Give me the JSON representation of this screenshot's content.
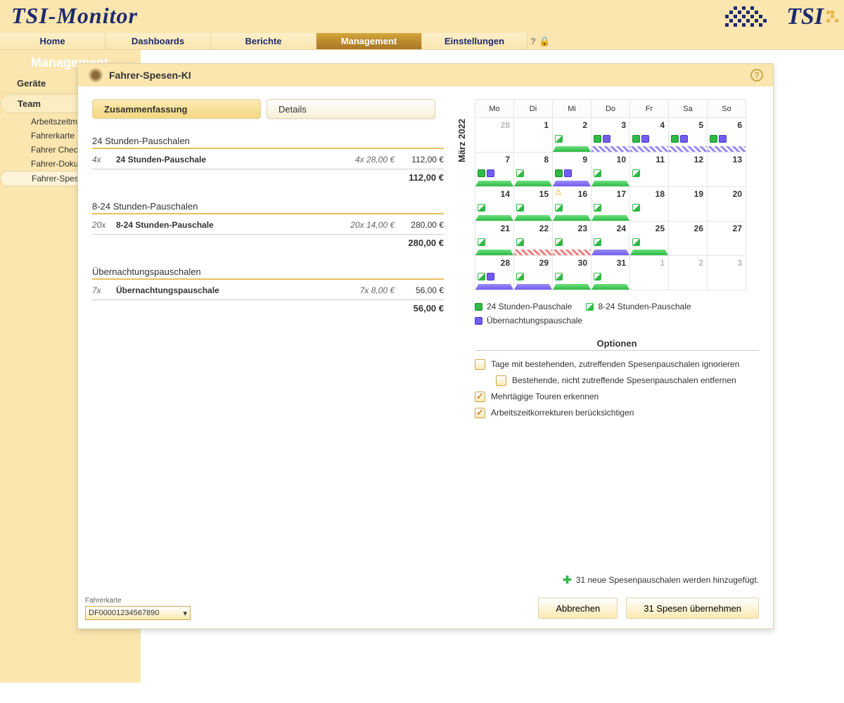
{
  "app_title": "TSI-Monitor",
  "nav": {
    "items": [
      "Home",
      "Dashboards",
      "Berichte",
      "Management",
      "Einstellungen"
    ],
    "active": 3
  },
  "sidebar": {
    "title": "Management",
    "items": [
      "Geräte",
      "Team"
    ],
    "subs": [
      "Arbeitszeitmodell",
      "Fahrerkarte",
      "Fahrer Check",
      "Fahrer-Dokumente",
      "Fahrer-Spesen-KI"
    ],
    "selected_sub": 4
  },
  "panel": {
    "title": "Fahrer-Spesen-KI"
  },
  "tabs": {
    "items": [
      "Zusammenfassung",
      "Details"
    ],
    "active": 0
  },
  "sections": [
    {
      "title": "24 Stunden-Pauschalen",
      "rows": [
        {
          "cnt": "4x",
          "lbl": "24 Stunden-Pauschale",
          "fr": "4x 28,00 €",
          "amt": "112,00 €"
        }
      ],
      "total": "112,00 €"
    },
    {
      "title": "8-24 Stunden-Pauschalen",
      "rows": [
        {
          "cnt": "20x",
          "lbl": "8-24 Stunden-Pauschale",
          "fr": "20x 14,00 €",
          "amt": "280,00 €"
        }
      ],
      "total": "280,00 €"
    },
    {
      "title": "Übernachtungspauschalen",
      "rows": [
        {
          "cnt": "7x",
          "lbl": "Übernachtungspauschale",
          "fr": "7x 8,00 €",
          "amt": "56,00 €"
        }
      ],
      "total": "56,00 €"
    }
  ],
  "calendar": {
    "month": "März 2022",
    "weekdays": [
      "Mo",
      "Di",
      "Mi",
      "Do",
      "Fr",
      "Sa",
      "So"
    ],
    "cells": [
      {
        "n": 28,
        "dim": true
      },
      {
        "n": 1,
        "marks": []
      },
      {
        "n": 2,
        "marks": [
          "go"
        ],
        "bar": "grn"
      },
      {
        "n": 3,
        "marks": [
          "g",
          "b"
        ],
        "bar": "blu-h"
      },
      {
        "n": 4,
        "marks": [
          "g",
          "b"
        ],
        "bar": "blu-h"
      },
      {
        "n": 5,
        "marks": [
          "g",
          "b"
        ],
        "bar": "blu-h"
      },
      {
        "n": 6,
        "marks": [
          "g",
          "b"
        ],
        "bar": "blu-h"
      },
      {
        "n": 7,
        "marks": [
          "g",
          "b"
        ],
        "bar": "grn"
      },
      {
        "n": 8,
        "marks": [
          "go"
        ],
        "bar": "grn"
      },
      {
        "n": 9,
        "marks": [
          "g",
          "b"
        ],
        "bar": "blu"
      },
      {
        "n": 10,
        "marks": [
          "go"
        ],
        "bar": "grn"
      },
      {
        "n": 11,
        "marks": [
          "go"
        ]
      },
      {
        "n": 12
      },
      {
        "n": 13
      },
      {
        "n": 14,
        "marks": [
          "go"
        ],
        "bar": "grn"
      },
      {
        "n": 15,
        "marks": [
          "go"
        ],
        "bar": "grn"
      },
      {
        "n": 16,
        "marks": [
          "go"
        ],
        "warn": true,
        "bar": "grn"
      },
      {
        "n": 17,
        "marks": [
          "go"
        ],
        "bar": "grn"
      },
      {
        "n": 18,
        "marks": [
          "go"
        ]
      },
      {
        "n": 19
      },
      {
        "n": 20
      },
      {
        "n": 21,
        "marks": [
          "go"
        ],
        "bar": "grn"
      },
      {
        "n": 22,
        "marks": [
          "go"
        ],
        "bar": "red-h"
      },
      {
        "n": 23,
        "marks": [
          "go"
        ],
        "bar": "red-h"
      },
      {
        "n": 24,
        "marks": [
          "go"
        ],
        "bar": "blu"
      },
      {
        "n": 25,
        "marks": [
          "go"
        ],
        "bar": "grn"
      },
      {
        "n": 26
      },
      {
        "n": 27
      },
      {
        "n": 28,
        "marks": [
          "go",
          "b"
        ],
        "bar": "blu"
      },
      {
        "n": 29,
        "marks": [
          "go"
        ],
        "bar": "blu"
      },
      {
        "n": 30,
        "marks": [
          "go"
        ],
        "bar": "grn"
      },
      {
        "n": 31,
        "marks": [
          "go"
        ],
        "bar": "grn"
      },
      {
        "n": 1,
        "dim": true
      },
      {
        "n": 2,
        "dim": true
      },
      {
        "n": 3,
        "dim": true
      }
    ]
  },
  "legend": {
    "items": [
      "24 Stunden-Pauschale",
      "8-24 Stunden-Pauschale",
      "Übernachtungspauschale"
    ]
  },
  "options": {
    "title": "Optionen",
    "items": [
      {
        "label": "Tage mit bestehenden, zutreffenden Spesenpauschalen ignorieren",
        "checked": false,
        "indent": false
      },
      {
        "label": "Bestehende, nicht zutreffende Spesenpauschalen entfernen",
        "checked": false,
        "indent": true
      },
      {
        "label": "Mehrtägige Touren erkennen",
        "checked": true,
        "indent": false
      },
      {
        "label": "Arbeitszeitkorrekturen berücksichtigen",
        "checked": true,
        "indent": false
      }
    ]
  },
  "footer": {
    "status": "31 neue Spesenpauschalen werden hinzugefügt.",
    "cancel": "Abbrechen",
    "submit": "31 Spesen übernehmen",
    "card_label": "Fahrerkarte",
    "card_value": "DF00001234567890"
  }
}
